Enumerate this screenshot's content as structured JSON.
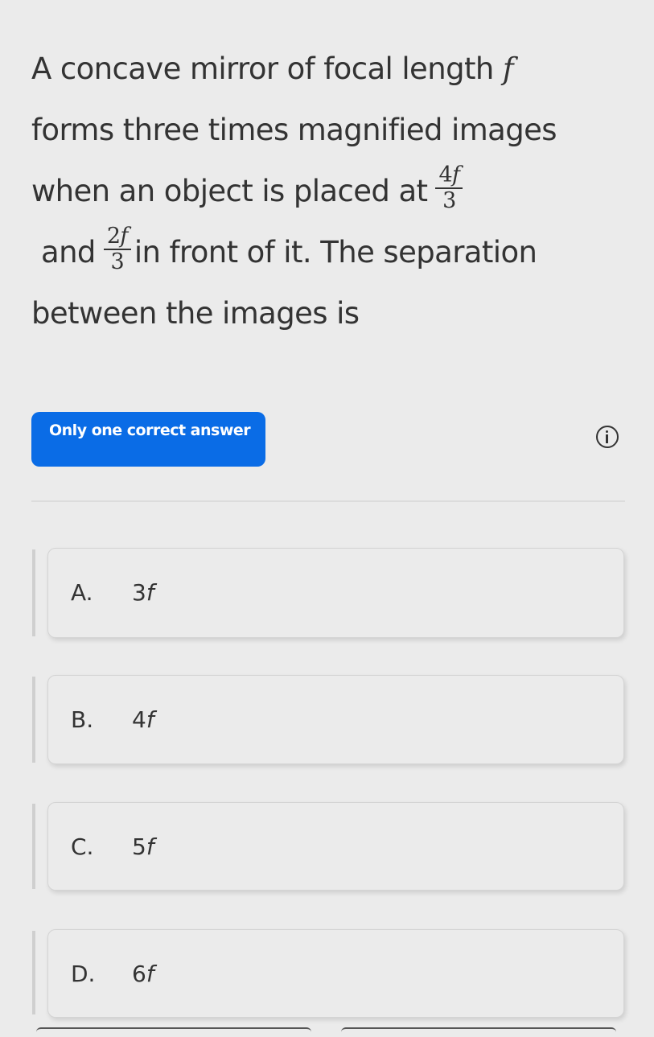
{
  "question": {
    "line1": "A concave mirror of focal length ",
    "line1_var": "f",
    "line2": "forms three times magnified images",
    "line3": "when an object is placed at",
    "frac1_num": "4",
    "frac1_var": "f",
    "frac1_den": "3",
    "line4_pre": "and",
    "frac2_num": "2",
    "frac2_var": "f",
    "frac2_den": "3",
    "line4_post": "in front of it. The separation",
    "line5": "between the images is"
  },
  "answer_type_badge": "Only one correct answer",
  "info_icon": "info-circle-icon",
  "options": [
    {
      "letter": "A.",
      "coef": "3",
      "var": "f"
    },
    {
      "letter": "B.",
      "coef": "4",
      "var": "f"
    },
    {
      "letter": "C.",
      "coef": "5",
      "var": "f"
    },
    {
      "letter": "D.",
      "coef": "6",
      "var": "f"
    }
  ],
  "colors": {
    "accent": "#0a6ce6",
    "background": "#ebebeb",
    "text": "#333333"
  }
}
